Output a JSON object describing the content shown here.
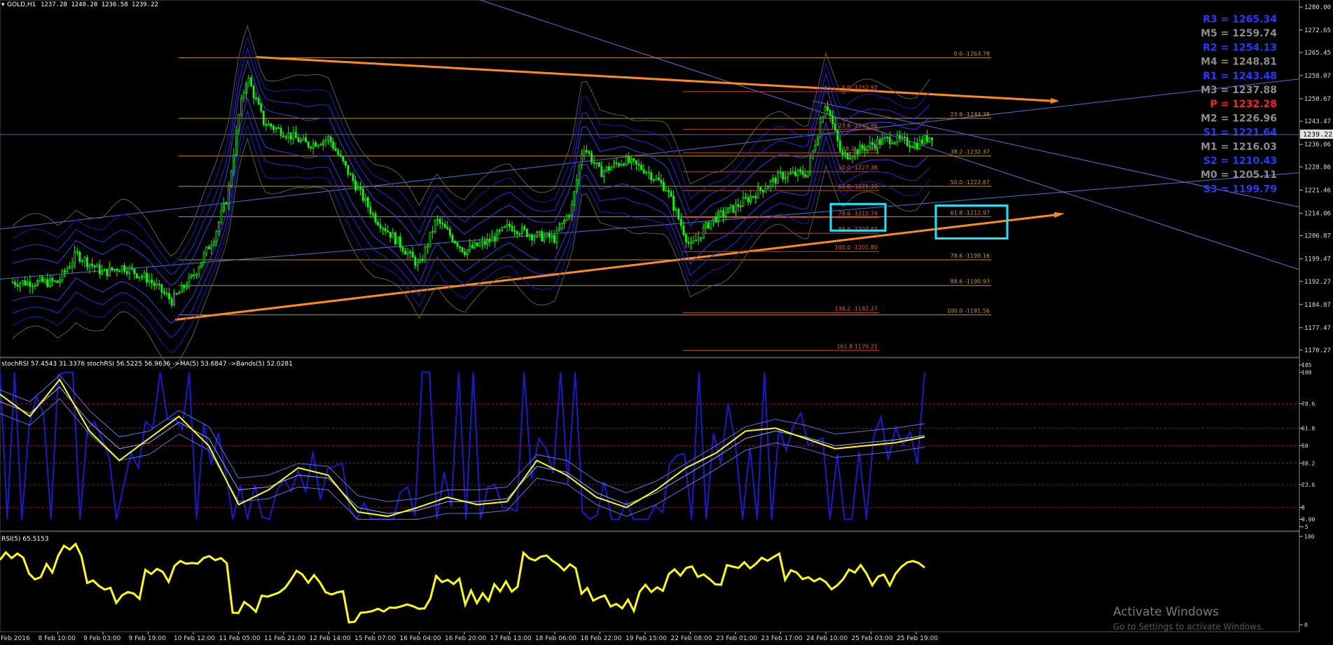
{
  "header": {
    "symbol_label": "GOLD,H1",
    "ohlc": "1237.28 1240.20 1236.58 1239.22"
  },
  "price_axis": {
    "ticks": [
      "1280.00",
      "1272.65",
      "1265.45",
      "1258.07",
      "1250.67",
      "1243.47",
      "1236.06",
      "1228.86",
      "1221.46",
      "1214.06",
      "1206.87",
      "1199.47",
      "1192.27",
      "1184.87",
      "1177.47",
      "1170.27"
    ],
    "current_price": "1239.22"
  },
  "stoch_axis": {
    "ticks": [
      "105",
      "100",
      "78.6",
      "61.8",
      "50",
      "38.2",
      "23.6",
      "8",
      "0.00",
      "-5"
    ]
  },
  "rsi_axis": {
    "ticks": [
      "100",
      "0"
    ]
  },
  "time_axis": {
    "labels": [
      "Feb 2016",
      "8 Feb 10:00",
      "9 Feb 03:00",
      "9 Feb 19:00",
      "10 Feb 12:00",
      "11 Feb 05:00",
      "11 Feb 21:00",
      "12 Feb 14:00",
      "15 Feb 07:00",
      "16 Feb 04:00",
      "16 Feb 20:00",
      "17 Feb 13:00",
      "18 Feb 06:00",
      "18 Feb 22:00",
      "19 Feb 15:00",
      "22 Feb 08:00",
      "23 Feb 01:00",
      "23 Feb 17:00",
      "24 Feb 10:00",
      "25 Feb 03:00",
      "25 Feb 19:00"
    ]
  },
  "pivots": [
    {
      "label": "R3 = 1265.34",
      "color": "#1f3cff"
    },
    {
      "label": "M5 = 1259.74",
      "color": "#8c8c8c"
    },
    {
      "label": "R2 = 1254.13",
      "color": "#1f3cff"
    },
    {
      "label": "M4 = 1248.81",
      "color": "#8c8c8c"
    },
    {
      "label": "R1 = 1243.48",
      "color": "#1f3cff"
    },
    {
      "label": "M3 = 1237.88",
      "color": "#8c8c8c"
    },
    {
      "label": "P = 1232.28",
      "color": "#ff2020"
    },
    {
      "label": "M2 = 1226.96",
      "color": "#8c8c8c"
    },
    {
      "label": "S1 = 1221.64",
      "color": "#1f3cff"
    },
    {
      "label": "M1 = 1216.03",
      "color": "#8c8c8c"
    },
    {
      "label": "S2 = 1210.43",
      "color": "#1f3cff"
    },
    {
      "label": "M0 = 1205.11",
      "color": "#8c8c8c"
    },
    {
      "label": "S3 = 1199.79",
      "color": "#1f3cff"
    }
  ],
  "fib_a": [
    {
      "label": "0.0 -1263.78",
      "price": 1263.78
    },
    {
      "label": "23.6 -1244.38",
      "price": 1244.38
    },
    {
      "label": "38.2 -1232.37",
      "price": 1232.37
    },
    {
      "label": "50.0 -1222.67",
      "price": 1222.67
    },
    {
      "label": "61.8 -1212.97",
      "price": 1212.97
    },
    {
      "label": "78.6 -1199.16",
      "price": 1199.16
    },
    {
      "label": "88.6 -1190.93",
      "price": 1190.93
    },
    {
      "label": "100.0 -1181.56",
      "price": 1181.56
    }
  ],
  "fib_b": [
    {
      "label": "0.0 -1252.92",
      "price": 1252.92
    },
    {
      "label": "23.6 -1240.86",
      "price": 1240.86
    },
    {
      "label": "38.2 -1233.4",
      "price": 1233.4
    },
    {
      "label": "50.0 -1227.36",
      "price": 1227.36
    },
    {
      "label": "61.8 -1221.33",
      "price": 1221.33
    },
    {
      "label": "78.6 -1212.74",
      "price": 1212.74
    },
    {
      "label": "88.6 -1207.63",
      "price": 1207.63
    },
    {
      "label": "100.0 -1201.80",
      "price": 1201.8
    },
    {
      "label": "138.2 -1182.27",
      "price": 1182.27
    },
    {
      "label": "161.8 1170.21",
      "price": 1170.21
    }
  ],
  "stoch_legend": "stochRSI 57.4543 31.3376  stochRSI 56.5225 56.9636  ->MA(5) 53.6847  ->Bands(5) 52.0281",
  "rsi_legend": "RSI(5) 65.5153",
  "watermark": {
    "title": "Activate Windows",
    "subtitle": "Go to Settings to activate Windows."
  },
  "colors": {
    "background": "#000000",
    "candle": "#00ff00",
    "rsi": "#ffff00",
    "trendline": "#ff8c1a",
    "fib": "#c8961e",
    "highlight": "#19e6ff"
  },
  "chart_data": [
    {
      "type": "candlestick",
      "symbol": "GOLD",
      "timeframe": "H1",
      "ylim": [
        1168,
        1283
      ],
      "close_path": [
        {
          "x": "8 Feb 10:00",
          "y": 1192
        },
        {
          "x": "8 Feb 17:00",
          "y": 1201
        },
        {
          "x": "9 Feb 03:00",
          "y": 1195
        },
        {
          "x": "9 Feb 10:00",
          "y": 1197
        },
        {
          "x": "9 Feb 19:00",
          "y": 1193
        },
        {
          "x": "10 Feb 04:00",
          "y": 1186
        },
        {
          "x": "10 Feb 12:00",
          "y": 1194
        },
        {
          "x": "10 Feb 20:00",
          "y": 1207
        },
        {
          "x": "11 Feb 01:00",
          "y": 1220
        },
        {
          "x": "11 Feb 05:00",
          "y": 1245
        },
        {
          "x": "11 Feb 08:00",
          "y": 1258
        },
        {
          "x": "11 Feb 14:00",
          "y": 1243
        },
        {
          "x": "11 Feb 21:00",
          "y": 1240
        },
        {
          "x": "12 Feb 06:00",
          "y": 1236
        },
        {
          "x": "12 Feb 14:00",
          "y": 1238
        },
        {
          "x": "12 Feb 22:00",
          "y": 1226
        },
        {
          "x": "15 Feb 07:00",
          "y": 1213
        },
        {
          "x": "15 Feb 18:00",
          "y": 1205
        },
        {
          "x": "16 Feb 04:00",
          "y": 1197
        },
        {
          "x": "16 Feb 10:00",
          "y": 1212
        },
        {
          "x": "16 Feb 20:00",
          "y": 1202
        },
        {
          "x": "17 Feb 05:00",
          "y": 1205
        },
        {
          "x": "17 Feb 13:00",
          "y": 1210
        },
        {
          "x": "17 Feb 22:00",
          "y": 1207
        },
        {
          "x": "18 Feb 06:00",
          "y": 1206
        },
        {
          "x": "18 Feb 12:00",
          "y": 1216
        },
        {
          "x": "18 Feb 16:00",
          "y": 1236
        },
        {
          "x": "18 Feb 22:00",
          "y": 1227
        },
        {
          "x": "19 Feb 07:00",
          "y": 1231
        },
        {
          "x": "19 Feb 15:00",
          "y": 1228
        },
        {
          "x": "19 Feb 23:00",
          "y": 1222
        },
        {
          "x": "22 Feb 08:00",
          "y": 1203
        },
        {
          "x": "22 Feb 16:00",
          "y": 1212
        },
        {
          "x": "23 Feb 01:00",
          "y": 1216
        },
        {
          "x": "23 Feb 09:00",
          "y": 1221
        },
        {
          "x": "23 Feb 17:00",
          "y": 1226
        },
        {
          "x": "24 Feb 03:00",
          "y": 1227
        },
        {
          "x": "24 Feb 10:00",
          "y": 1250
        },
        {
          "x": "24 Feb 16:00",
          "y": 1232
        },
        {
          "x": "25 Feb 03:00",
          "y": 1236
        },
        {
          "x": "25 Feb 10:00",
          "y": 1238
        },
        {
          "x": "25 Feb 19:00",
          "y": 1236
        },
        {
          "x": "26 Feb 01:00",
          "y": 1239.22
        }
      ]
    },
    {
      "type": "line",
      "panel": "stochRSI",
      "ylim": [
        -5,
        105
      ],
      "series": [
        {
          "name": "stochRSI",
          "values": [
            85,
            70,
            95,
            60,
            40,
            55,
            70,
            50,
            10,
            20,
            35,
            30,
            5,
            2,
            8,
            15,
            10,
            12,
            40,
            30,
            15,
            8,
            20,
            35,
            45,
            60,
            62,
            55,
            48,
            50,
            52,
            56
          ]
        },
        {
          "name": "stochRSI",
          "values": [
            80,
            72,
            90,
            66,
            48,
            52,
            66,
            55,
            20,
            22,
            30,
            28,
            8,
            4,
            6,
            12,
            12,
            14,
            36,
            32,
            18,
            10,
            18,
            30,
            42,
            55,
            60,
            56,
            50,
            52,
            54,
            57
          ]
        }
      ]
    },
    {
      "type": "line",
      "panel": "RSI(5)",
      "ylim": [
        0,
        100
      ],
      "series": [
        {
          "name": "RSI(5)",
          "values": [
            75,
            60,
            85,
            45,
            30,
            55,
            65,
            70,
            20,
            35,
            55,
            40,
            10,
            15,
            25,
            50,
            30,
            45,
            80,
            70,
            35,
            20,
            40,
            60,
            50,
            70,
            75,
            55,
            45,
            60,
            50,
            65
          ]
        }
      ]
    }
  ]
}
